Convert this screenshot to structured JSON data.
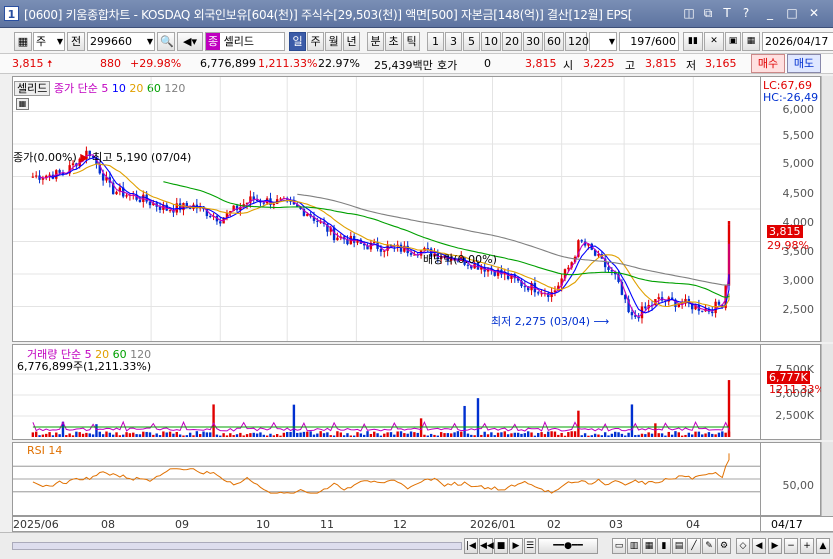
{
  "window": {
    "title": "[0600] 키움종합차트 - KOSDAQ 외국인보유[604(천)] 주식수[29,503(천)] 액면[500] 자본금[148(억)] 결산[12월] EPS[",
    "app_icon": "1",
    "buttons": [
      "◫",
      "⧉",
      "T",
      "?",
      "_",
      "□",
      "✕"
    ]
  },
  "toolbar": {
    "type_select": "주",
    "jeon_button": "전",
    "code_input": "299660",
    "stock_name": "셀리드",
    "stock_badge": "종",
    "periods": [
      "일",
      "주",
      "월",
      "년",
      "분",
      "초",
      "틱"
    ],
    "active_period": "일",
    "intervals": [
      "1",
      "3",
      "5",
      "10",
      "20",
      "30",
      "60",
      "120"
    ],
    "count": "197/600",
    "date": "2026/04/17"
  },
  "quote": {
    "price": "3,815",
    "change": "880",
    "change_pct": "+29.98%",
    "volume": "6,776,899",
    "volume_pct": "1,211.33%",
    "turnover": "22.97%",
    "amount": "25,439백만",
    "hoga_label": "호가",
    "hoga_value": "0",
    "hoga_price": "3,815",
    "open_label": "시",
    "open": "3,225",
    "high_label": "고",
    "high": "3,815",
    "low_label": "저",
    "low": "3,165",
    "buy_button": "매수",
    "sell_button": "매도"
  },
  "price_pane": {
    "name_tag": "셀리드",
    "ma_legend": [
      {
        "label": "종가 단순",
        "color": "#c000c0"
      },
      {
        "label": "5",
        "color": "#c000c0"
      },
      {
        "label": "10",
        "color": "#0000ff"
      },
      {
        "label": "20",
        "color": "#e0a000"
      },
      {
        "label": "60",
        "color": "#00a000"
      },
      {
        "label": "120",
        "color": "#808080"
      }
    ],
    "lc": "LC:67,69",
    "hc": "HC:-26,49",
    "ticks": [
      "6,000",
      "5,500",
      "5,000",
      "4,500",
      "4,000",
      "3,500",
      "3,000",
      "2,500"
    ],
    "last_price_tag": "3,815",
    "last_pct_tag": "29,98%",
    "high_annotation": "최고 5,190 (07/04)",
    "high_annotation_prefix": "종가(0.00%)",
    "low_annotation": "최저 2,275 (03/04)",
    "dividend_annotation": "배당락(0.00%)"
  },
  "volume_pane": {
    "legend": [
      {
        "label": "거래량",
        "color": "#c000c0"
      },
      {
        "label": "단순",
        "color": "#c000c0"
      },
      {
        "label": "5",
        "color": "#c000c0"
      },
      {
        "label": "20",
        "color": "#e0a000"
      },
      {
        "label": "60",
        "color": "#00a000"
      },
      {
        "label": "120",
        "color": "#808080"
      }
    ],
    "value_text": "6,776,899주(1,211.33%)",
    "ticks": [
      "7,500K",
      "5,000K",
      "2,500K"
    ],
    "last_tag": "6,777K",
    "pct_tag": "1211.33%"
  },
  "rsi_pane": {
    "legend": "RSI 14",
    "ticks": [
      "50,00"
    ]
  },
  "date_axis": {
    "labels": [
      "2025/06",
      "08",
      "09",
      "10",
      "11",
      "12",
      "2026/01",
      "02",
      "03",
      "04"
    ],
    "right_label": "04/17"
  },
  "colors": {
    "up": "#e00000",
    "down": "#0030d0",
    "ma5": "#c000c0",
    "ma10": "#0000ff",
    "ma20": "#e0a000",
    "ma60": "#00a000",
    "ma120": "#808080",
    "rsi": "#e07000"
  },
  "chart_data": {
    "type": "line",
    "x_range": [
      "2025/06",
      "2026/04/17"
    ],
    "ylim": [
      2000,
      6000
    ],
    "close_series": [
      [
        "2025-06-09",
        4500
      ],
      [
        "2025-06-23",
        4550
      ],
      [
        "2025-07-04",
        4900
      ],
      [
        "2025-07-14",
        4300
      ],
      [
        "2025-07-28",
        4150
      ],
      [
        "2025-08-08",
        4000
      ],
      [
        "2025-08-20",
        4050
      ],
      [
        "2025-09-01",
        3850
      ],
      [
        "2025-09-15",
        4150
      ],
      [
        "2025-09-29",
        4100
      ],
      [
        "2025-10-10",
        3950
      ],
      [
        "2025-10-22",
        3600
      ],
      [
        "2025-11-03",
        3450
      ],
      [
        "2025-11-17",
        3400
      ],
      [
        "2025-12-01",
        3350
      ],
      [
        "2025-12-15",
        3250
      ],
      [
        "2026-01-02",
        3050
      ],
      [
        "2026-01-14",
        2850
      ],
      [
        "2026-01-28",
        2700
      ],
      [
        "2026-02-05",
        3150
      ],
      [
        "2026-02-09",
        3500
      ],
      [
        "2026-02-13",
        3400
      ],
      [
        "2026-02-25",
        2950
      ],
      [
        "2026-03-04",
        2300
      ],
      [
        "2026-03-16",
        2600
      ],
      [
        "2026-03-27",
        2550
      ],
      [
        "2026-04-08",
        2450
      ],
      [
        "2026-04-14",
        2550
      ],
      [
        "2026-04-16",
        2935
      ],
      [
        "2026-04-17",
        3815
      ]
    ],
    "high": {
      "value": 5190,
      "date": "07/04"
    },
    "low": {
      "value": 2275,
      "date": "03/04"
    },
    "last": 3815,
    "last_change_pct": 29.98,
    "volume_ylim": [
      0,
      10000000
    ],
    "volume_last": 6776899,
    "rsi_ticks": [
      50
    ]
  }
}
